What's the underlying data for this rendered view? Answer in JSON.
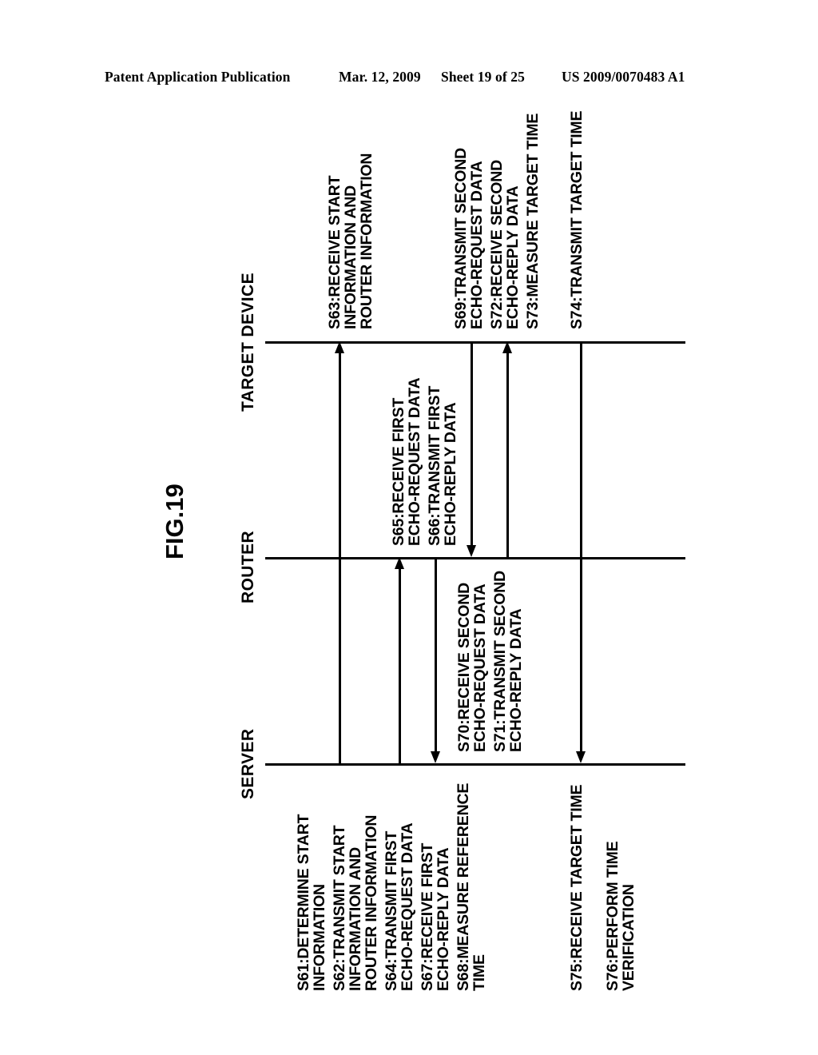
{
  "header": {
    "publication": "Patent Application Publication",
    "date": "Mar. 12, 2009",
    "sheet": "Sheet 19 of 25",
    "patent_number": "US 2009/0070483 A1"
  },
  "figure": {
    "label": "FIG.19",
    "type": "sequence-diagram",
    "lanes": [
      {
        "id": "target-device",
        "label": "TARGET DEVICE"
      },
      {
        "id": "router",
        "label": "ROUTER"
      },
      {
        "id": "server",
        "label": "SERVER"
      }
    ],
    "steps": [
      {
        "id": "S61",
        "lane": "server",
        "text": "S61:DETERMINE START\nINFORMATION"
      },
      {
        "id": "S62",
        "lane": "server",
        "text": "S62:TRANSMIT START\nINFORMATION AND\nROUTER INFORMATION"
      },
      {
        "id": "S63",
        "lane": "target-device",
        "text": "S63:RECEIVE START\nINFORMATION AND\nROUTER INFORMATION"
      },
      {
        "id": "S64",
        "lane": "server",
        "text": "S64:TRANSMIT FIRST\nECHO-REQUEST DATA"
      },
      {
        "id": "S65",
        "lane": "router",
        "text": "S65:RECEIVE FIRST\nECHO-REQUEST DATA"
      },
      {
        "id": "S66",
        "lane": "router",
        "text": "S66:TRANSMIT FIRST\nECHO-REPLY DATA"
      },
      {
        "id": "S67",
        "lane": "server",
        "text": "S67:RECEIVE FIRST\nECHO-REPLY DATA"
      },
      {
        "id": "S68",
        "lane": "server",
        "text": "S68:MEASURE REFERENCE\nTIME"
      },
      {
        "id": "S69",
        "lane": "target-device",
        "text": "S69:TRANSMIT SECOND\nECHO-REQUEST DATA"
      },
      {
        "id": "S70",
        "lane": "router",
        "text": "S70:RECEIVE SECOND\nECHO-REQUEST DATA"
      },
      {
        "id": "S71",
        "lane": "router",
        "text": "S71:TRANSMIT SECOND\nECHO-REPLY DATA"
      },
      {
        "id": "S72",
        "lane": "target-device",
        "text": "S72:RECEIVE SECOND\nECHO-REPLY DATA"
      },
      {
        "id": "S73",
        "lane": "target-device",
        "text": "S73:MEASURE TARGET TIME"
      },
      {
        "id": "S74",
        "lane": "target-device",
        "text": "S74:TRANSMIT TARGET TIME"
      },
      {
        "id": "S75",
        "lane": "server",
        "text": "S75:RECEIVE TARGET TIME"
      },
      {
        "id": "S76",
        "lane": "server",
        "text": "S76:PERFORM TIME\nVERIFICATION"
      }
    ],
    "messages": [
      {
        "id": "S62-msg",
        "from": "server",
        "to": "target-device"
      },
      {
        "id": "S64-msg",
        "from": "server",
        "to": "router"
      },
      {
        "id": "S66-msg",
        "from": "target-device",
        "to": "router"
      },
      {
        "id": "S71-msg",
        "from": "router",
        "to": "server"
      },
      {
        "id": "S69-msg",
        "from": "router",
        "to": "target-device"
      },
      {
        "id": "S74-msg",
        "from": "target-device",
        "to": "server"
      }
    ]
  }
}
